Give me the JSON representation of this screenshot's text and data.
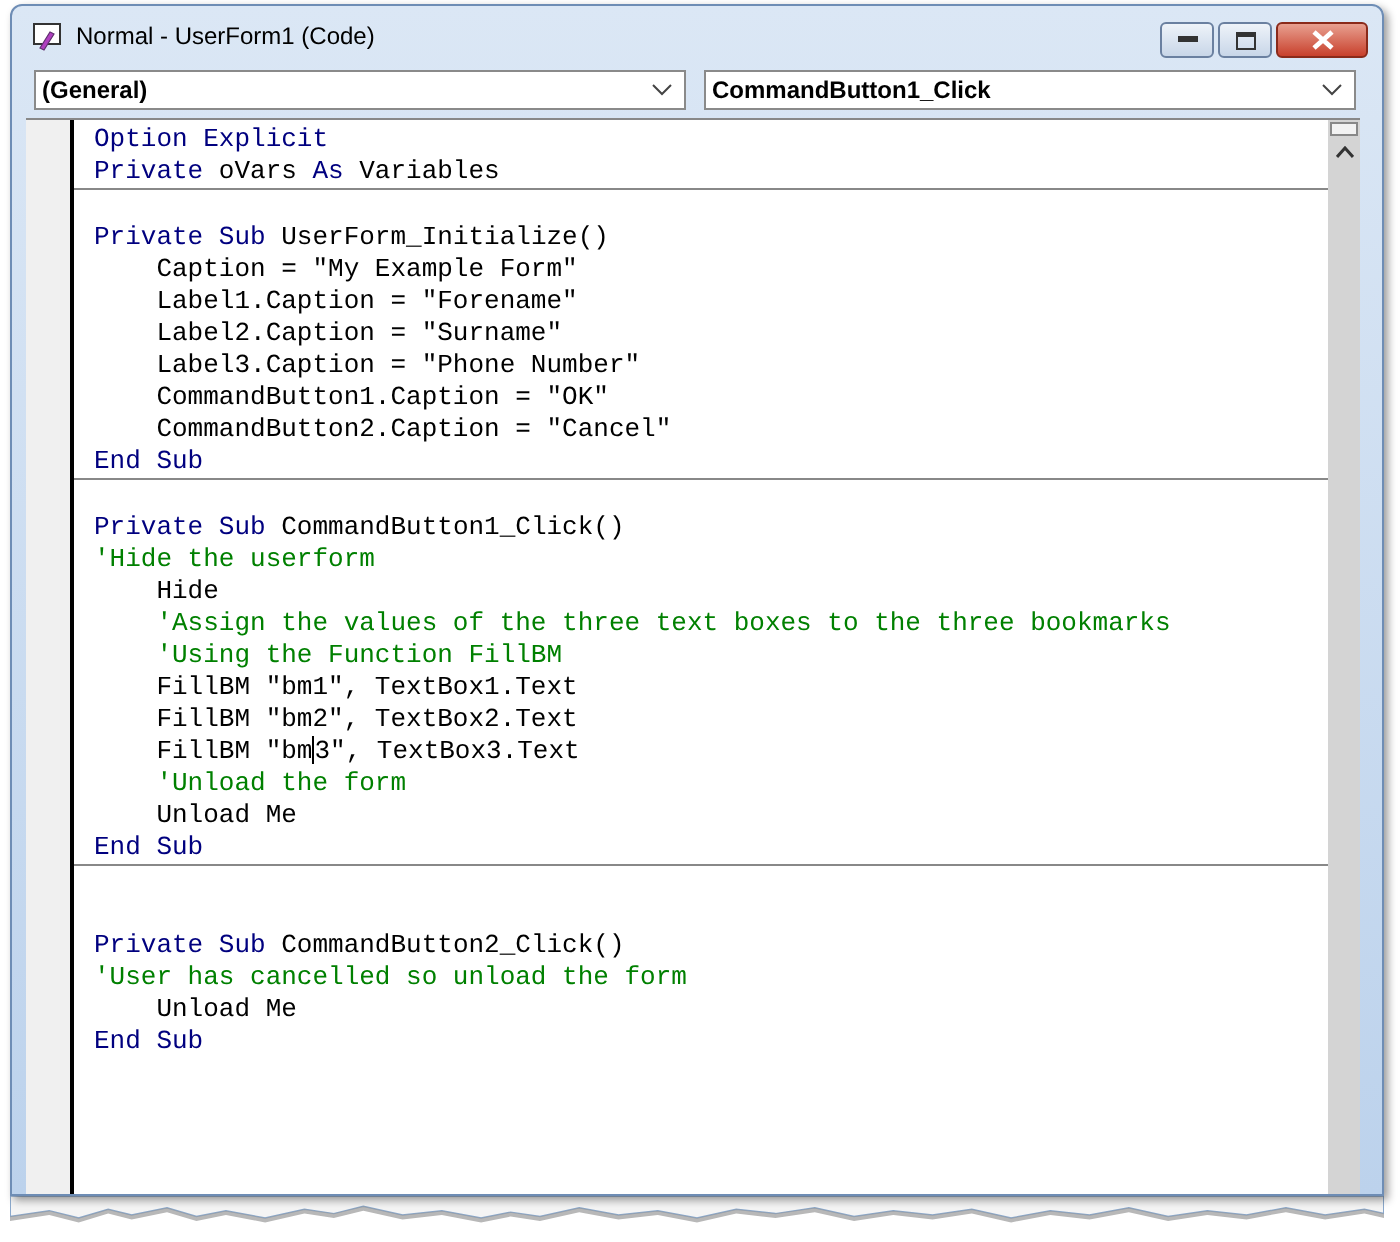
{
  "window": {
    "title": "Normal - UserForm1 (Code)"
  },
  "object_dropdown": {
    "value": "(General)"
  },
  "procedure_dropdown": {
    "value": "CommandButton1_Click"
  },
  "procedures": [
    {
      "lines": [
        {
          "kind": "code",
          "segments": [
            {
              "text": "Option Explicit",
              "kind": "keyword"
            }
          ]
        },
        {
          "kind": "code",
          "segments": [
            {
              "text": "Private",
              "kind": "keyword"
            },
            {
              "text": " oVars ",
              "kind": "plain"
            },
            {
              "text": "As",
              "kind": "keyword"
            },
            {
              "text": " Variables",
              "kind": "plain"
            }
          ]
        }
      ]
    },
    {
      "lines": [
        {
          "kind": "blank"
        },
        {
          "kind": "code",
          "segments": [
            {
              "text": "Private Sub",
              "kind": "keyword"
            },
            {
              "text": " UserForm_Initialize()",
              "kind": "plain"
            }
          ]
        },
        {
          "kind": "code",
          "segments": [
            {
              "text": "    Caption = \"My Example Form\"",
              "kind": "plain"
            }
          ]
        },
        {
          "kind": "code",
          "segments": [
            {
              "text": "    Label1.Caption = \"Forename\"",
              "kind": "plain"
            }
          ]
        },
        {
          "kind": "code",
          "segments": [
            {
              "text": "    Label2.Caption = \"Surname\"",
              "kind": "plain"
            }
          ]
        },
        {
          "kind": "code",
          "segments": [
            {
              "text": "    Label3.Caption = \"Phone Number\"",
              "kind": "plain"
            }
          ]
        },
        {
          "kind": "code",
          "segments": [
            {
              "text": "    CommandButton1.Caption = \"OK\"",
              "kind": "plain"
            }
          ]
        },
        {
          "kind": "code",
          "segments": [
            {
              "text": "    CommandButton2.Caption = \"Cancel\"",
              "kind": "plain"
            }
          ]
        },
        {
          "kind": "code",
          "segments": [
            {
              "text": "End Sub",
              "kind": "keyword"
            }
          ]
        }
      ]
    },
    {
      "lines": [
        {
          "kind": "blank"
        },
        {
          "kind": "code",
          "segments": [
            {
              "text": "Private Sub",
              "kind": "keyword"
            },
            {
              "text": " CommandButton1_Click()",
              "kind": "plain"
            }
          ]
        },
        {
          "kind": "code",
          "segments": [
            {
              "text": "'Hide the userform",
              "kind": "comment"
            }
          ]
        },
        {
          "kind": "code",
          "segments": [
            {
              "text": "    Hide",
              "kind": "plain"
            }
          ]
        },
        {
          "kind": "code",
          "segments": [
            {
              "text": "    'Assign the values of the three text boxes to the three bookmarks",
              "kind": "comment"
            }
          ]
        },
        {
          "kind": "code",
          "segments": [
            {
              "text": "    'Using the Function FillBM",
              "kind": "comment"
            }
          ]
        },
        {
          "kind": "code",
          "segments": [
            {
              "text": "    FillBM \"bm1\", TextBox1.Text",
              "kind": "plain"
            }
          ]
        },
        {
          "kind": "code",
          "segments": [
            {
              "text": "    FillBM \"bm2\", TextBox2.Text",
              "kind": "plain"
            }
          ]
        },
        {
          "kind": "code",
          "segments": [
            {
              "text": "    FillBM \"bm",
              "kind": "plain",
              "caret_after": true
            },
            {
              "text": "3\", TextBox3.Text",
              "kind": "plain"
            }
          ]
        },
        {
          "kind": "code",
          "segments": [
            {
              "text": "    'Unload the form",
              "kind": "comment"
            }
          ]
        },
        {
          "kind": "code",
          "segments": [
            {
              "text": "    Unload Me",
              "kind": "plain"
            }
          ]
        },
        {
          "kind": "code",
          "segments": [
            {
              "text": "End Sub",
              "kind": "keyword"
            }
          ]
        }
      ]
    },
    {
      "lines": [
        {
          "kind": "blank"
        },
        {
          "kind": "blank"
        },
        {
          "kind": "code",
          "segments": [
            {
              "text": "Private Sub",
              "kind": "keyword"
            },
            {
              "text": " CommandButton2_Click()",
              "kind": "plain"
            }
          ]
        },
        {
          "kind": "code",
          "segments": [
            {
              "text": "'User has cancelled so unload the form",
              "kind": "comment"
            }
          ]
        },
        {
          "kind": "code",
          "segments": [
            {
              "text": "    Unload Me",
              "kind": "plain"
            }
          ]
        },
        {
          "kind": "code",
          "segments": [
            {
              "text": "End Sub",
              "kind": "keyword"
            }
          ]
        }
      ]
    }
  ]
}
